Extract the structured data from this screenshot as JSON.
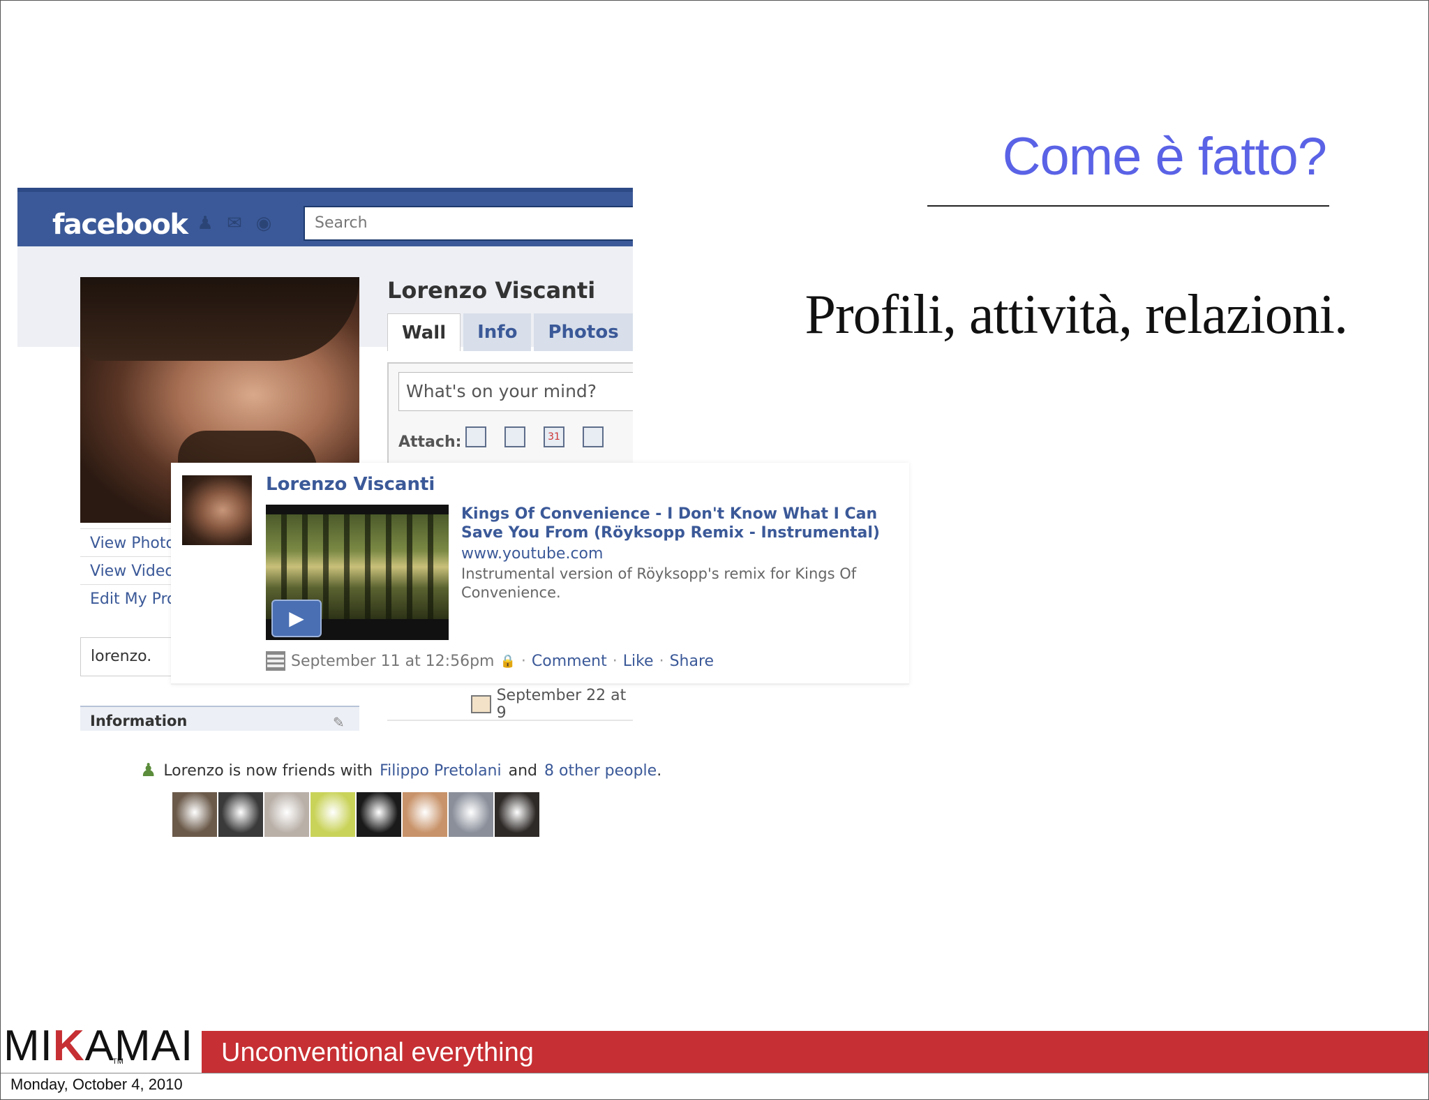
{
  "slide": {
    "title": "Come è fatto?",
    "subtitle": "Profili, attività, relazioni."
  },
  "facebook": {
    "logo": "facebook",
    "search_placeholder": "Search",
    "profile_name": "Lorenzo Viscanti",
    "tabs": [
      {
        "label": "Wall",
        "active": true
      },
      {
        "label": "Info",
        "active": false
      },
      {
        "label": "Photos",
        "active": false
      }
    ],
    "composer_placeholder": "What's on your mind?",
    "attach_label": "Attach:",
    "calendar_day": "31",
    "side_links": [
      "View Photo",
      "View Video",
      "Edit My Pro"
    ],
    "side_box": "lorenzo.",
    "information_label": "Information",
    "older_post_date": "September 22 at 9",
    "post": {
      "author": "Lorenzo Viscanti",
      "link_title": "Kings Of Convenience - I Don't Know What I Can Save You From (Röyksopp Remix - Instrumental)",
      "link_url": "www.youtube.com",
      "link_description": "Instrumental version of Röyksopp's remix for Kings Of Convenience.",
      "timestamp": "September 11 at 12:56pm",
      "separator": "·",
      "comment": "Comment",
      "like": "Like",
      "share": "Share"
    },
    "friends_story": {
      "prefix": "Lorenzo is now friends with",
      "friend": "Filippo Pretolani",
      "and": "and",
      "others": "8 other people",
      "suffix": "."
    },
    "thumb_colors": [
      "#6b5a4a",
      "#3a3a3a",
      "#b9b0a8",
      "#c9d35a",
      "#1a1a1a",
      "#c8936a",
      "#8a8f9a",
      "#2e2a28"
    ]
  },
  "footer": {
    "brand_left": "MI",
    "brand_k": "K",
    "brand_right": "AMAI",
    "trademark": "TM",
    "tagline": "Unconventional everything",
    "date": "Monday, October 4, 2010"
  },
  "colors": {
    "title": "#5a62e6",
    "facebook_blue": "#3b5998",
    "footer_red": "#c62f33"
  }
}
